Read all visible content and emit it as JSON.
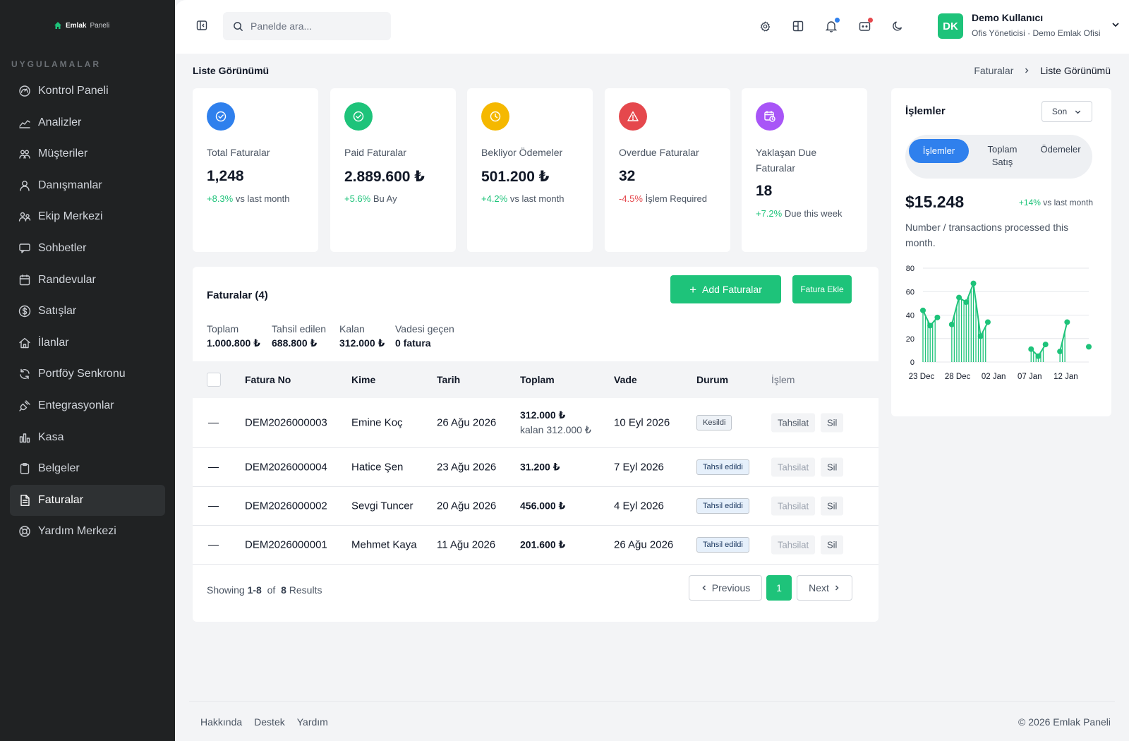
{
  "brand": {
    "name": "Emlak",
    "sub": "Paneli"
  },
  "sidebar": {
    "section_title": "UYGULAMALAR",
    "items": [
      {
        "label": "Kontrol Paneli",
        "icon": "gauge-icon"
      },
      {
        "label": "Analizler",
        "icon": "chart-line-icon"
      },
      {
        "label": "Müşteriler",
        "icon": "users-icon"
      },
      {
        "label": "Danışmanlar",
        "icon": "user-icon"
      },
      {
        "label": "Ekip Merkezi",
        "icon": "team-icon"
      },
      {
        "label": "Sohbetler",
        "icon": "chat-icon"
      },
      {
        "label": "Randevular",
        "icon": "calendar-icon"
      },
      {
        "label": "Satışlar",
        "icon": "dollar-icon"
      },
      {
        "label": "İlanlar",
        "icon": "home-icon"
      },
      {
        "label": "Portföy Senkronu",
        "icon": "sync-icon"
      },
      {
        "label": "Entegrasyonlar",
        "icon": "plug-icon"
      },
      {
        "label": "Kasa",
        "icon": "bar-chart-icon"
      },
      {
        "label": "Belgeler",
        "icon": "clipboard-icon"
      },
      {
        "label": "Faturalar",
        "icon": "invoice-icon"
      },
      {
        "label": "Yardım Merkezi",
        "icon": "lifebuoy-icon"
      }
    ],
    "active_index": 13
  },
  "topbar": {
    "search_placeholder": "Panelde ara...",
    "user_initials": "DK",
    "user_name": "Demo Kullanıcı",
    "user_role": "Ofis Yöneticisi · Demo Emlak Ofisi",
    "accent": "#1ec37a"
  },
  "page": {
    "title": "Liste Görünümü",
    "breadcrumb": [
      "Faturalar",
      "Liste Görünümü"
    ]
  },
  "stats": [
    {
      "label": "Total Faturalar",
      "value": "1,248",
      "change": "+8.3%",
      "change_text": "vs last month",
      "trend": "up",
      "icon": "check-circle-icon",
      "color": "#2f80ed"
    },
    {
      "label": "Paid Faturalar",
      "value": "2.889.600 ₺",
      "change": "+5.6%",
      "change_text": "Bu Ay",
      "trend": "up",
      "icon": "check-circle-icon",
      "color": "#1ec37a"
    },
    {
      "label": "Bekliyor Ödemeler",
      "value": "501.200 ₺",
      "change": "+4.2%",
      "change_text": "vs last month",
      "trend": "up",
      "icon": "clock-icon",
      "color": "#f5b800"
    },
    {
      "label": "Overdue Faturalar",
      "value": "32",
      "change": "-4.5%",
      "change_text": "İşlem Required",
      "trend": "down",
      "icon": "warning-icon",
      "color": "#e5484d"
    },
    {
      "label": "Yaklaşan Due Faturalar",
      "value": "18",
      "change": "+7.2%",
      "change_text": "Due this week",
      "trend": "up",
      "icon": "calendar-clock-icon",
      "color": "#a855f7"
    }
  ],
  "invoices": {
    "title": "Faturalar (4)",
    "add_button": "Add Faturalar",
    "add_button2": "Fatura Ekle",
    "summary": [
      {
        "label": "Toplam",
        "value": "1.000.800 ₺"
      },
      {
        "label": "Tahsil edilen",
        "value": "688.800 ₺"
      },
      {
        "label": "Kalan",
        "value": "312.000 ₺"
      },
      {
        "label": "Vadesi geçen",
        "value": "0 fatura"
      }
    ],
    "columns": [
      "Fatura No",
      "Kime",
      "Tarih",
      "Toplam",
      "Vade",
      "Durum",
      "İşlem"
    ],
    "rows": [
      {
        "select": "—",
        "no": "DEM2026000003",
        "to": "Emine Koç",
        "date": "26 Ağu 2026",
        "total": "312.000 ₺",
        "total_sub": "kalan 312.000 ₺",
        "due": "10 Eyl 2026",
        "status": "Kesildi",
        "action1": "Tahsilat",
        "action2": "Sil"
      },
      {
        "select": "—",
        "no": "DEM2026000004",
        "to": "Hatice Şen",
        "date": "23 Ağu 2026",
        "total": "31.200 ₺",
        "total_sub": "",
        "due": "7 Eyl 2026",
        "status": "Tahsil edildi",
        "action1": "Tahsilat",
        "action2": "Sil"
      },
      {
        "select": "—",
        "no": "DEM2026000002",
        "to": "Sevgi Tuncer",
        "date": "20 Ağu 2026",
        "total": "456.000 ₺",
        "total_sub": "",
        "due": "4 Eyl 2026",
        "status": "Tahsil edildi",
        "action1": "Tahsilat",
        "action2": "Sil"
      },
      {
        "select": "—",
        "no": "DEM2026000001",
        "to": "Mehmet Kaya",
        "date": "11 Ağu 2026",
        "total": "201.600 ₺",
        "total_sub": "",
        "due": "26 Ağu 2026",
        "status": "Tahsil edildi",
        "action1": "Tahsilat",
        "action2": "Sil"
      }
    ],
    "pagination": {
      "showing_prefix": "Showing",
      "range": "1-8",
      "of": "of",
      "total": "8",
      "results": "Results",
      "prev": "Previous",
      "page": "1",
      "next": "Next"
    }
  },
  "transactions": {
    "title": "İşlemler",
    "select_value": "Son",
    "tabs": [
      "İşlemler",
      "Toplam Satış",
      "Ödemeler"
    ],
    "active_tab": 0,
    "value": "$15.248",
    "change": "+14%",
    "change_text": "vs last month",
    "description": "Number / transactions processed this month."
  },
  "chart_data": {
    "type": "line",
    "x_tick_labels": [
      "23 Dec",
      "28 Dec",
      "02 Jan",
      "07 Jan",
      "12 Jan"
    ],
    "y_ticks": [
      0,
      20,
      40,
      60,
      80
    ],
    "ylim": [
      0,
      80
    ],
    "xlim": [
      0,
      23
    ],
    "color": "#1ec37a",
    "segments": [
      [
        [
          0,
          44
        ],
        [
          1,
          31
        ],
        [
          2,
          38
        ]
      ],
      [
        [
          4,
          32
        ],
        [
          5,
          55
        ],
        [
          6,
          51
        ],
        [
          7,
          67
        ],
        [
          8,
          22
        ],
        [
          9,
          34
        ]
      ],
      [
        [
          15,
          11
        ],
        [
          16,
          5
        ],
        [
          17,
          15
        ]
      ],
      [
        [
          19,
          9
        ],
        [
          20,
          34
        ]
      ],
      [
        [
          23,
          13
        ]
      ]
    ],
    "grid": true
  },
  "footer": {
    "links": [
      "Hakkında",
      "Destek",
      "Yardım"
    ],
    "copyright": "© 2026 Emlak Paneli"
  }
}
